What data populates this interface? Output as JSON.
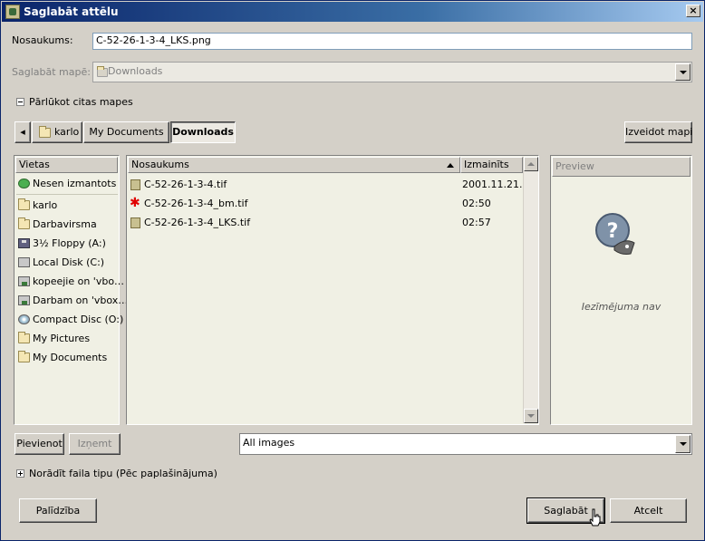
{
  "window": {
    "title": "Saglabāt attēlu",
    "close_glyph": "×"
  },
  "name_row": {
    "label": "Nosaukums:",
    "value": "C-52-26-1-3-4_LKS.png"
  },
  "folder_row": {
    "label": "Saglabāt mapē:",
    "value": "Downloads"
  },
  "browse_toggle": {
    "label": "Pārlūkot citas mapes"
  },
  "path_bar": {
    "back_glyph": "◂",
    "crumbs": [
      "karlo",
      "My Documents",
      "Downloads"
    ],
    "active": "Downloads"
  },
  "create_folder_button": "Izveidot mapi",
  "places": {
    "header": "Vietas",
    "items": [
      {
        "label": "Nesen izmantots",
        "icon": "recent-icon"
      },
      {
        "label": "karlo",
        "icon": "folder-icon"
      },
      {
        "label": "Darbavirsma",
        "icon": "folder-icon"
      },
      {
        "label": "3½ Floppy (A:)",
        "icon": "floppy-icon"
      },
      {
        "label": "Local Disk (C:)",
        "icon": "drive-icon"
      },
      {
        "label": "kopeejie on 'vbo…",
        "icon": "network-drive-icon"
      },
      {
        "label": "Darbam on 'vbox…",
        "icon": "network-drive-icon"
      },
      {
        "label": "Compact Disc (O:)",
        "icon": "cd-icon"
      },
      {
        "label": "My Pictures",
        "icon": "folder-icon"
      },
      {
        "label": "My Documents",
        "icon": "folder-icon"
      }
    ]
  },
  "files": {
    "col_name": "Nosaukums",
    "col_modified": "Izmainīts",
    "rows": [
      {
        "name": "C-52-26-1-3-4.tif",
        "modified": "2001.11.21.",
        "icon": "image-file-icon"
      },
      {
        "name": "C-52-26-1-3-4_bm.tif",
        "modified": "02:50",
        "icon": "red-image-file-icon"
      },
      {
        "name": "C-52-26-1-3-4_LKS.tif",
        "modified": "02:57",
        "icon": "image-file-icon"
      }
    ]
  },
  "preview": {
    "header": "Preview",
    "empty_text": "Iezīmējuma nav"
  },
  "add_button": "Pievienot",
  "remove_button": "Izņemt",
  "filter": {
    "value": "All images"
  },
  "file_type_toggle": {
    "label": "Norādīt faila tipu (Pēc paplašinājuma)"
  },
  "help_button": "Palīdzība",
  "save_button": "Saglabāt",
  "cancel_button": "Atcelt"
}
